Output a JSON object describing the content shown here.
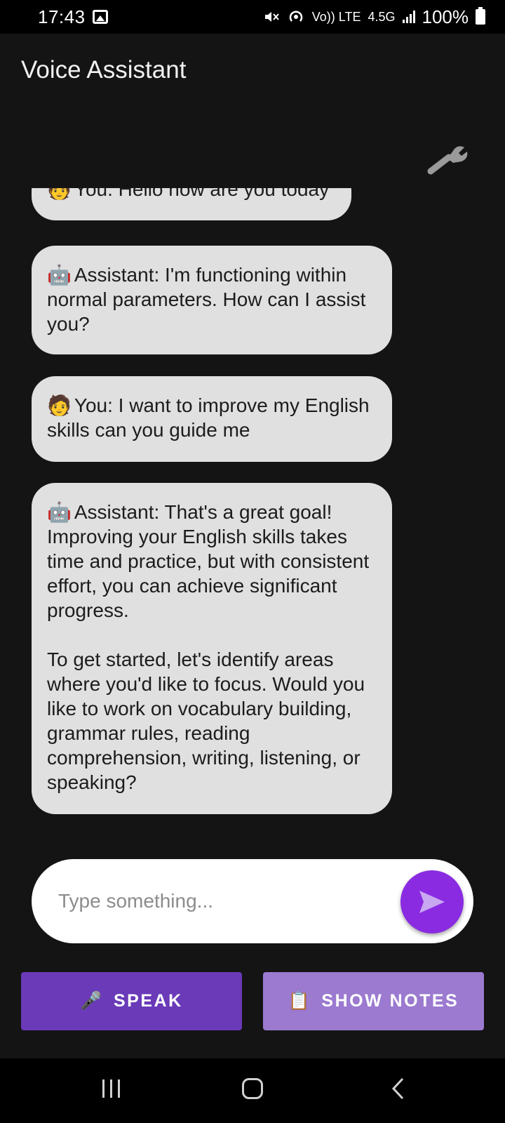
{
  "status_bar": {
    "time": "17:43",
    "volte": "Vo)) LTE",
    "network": "4.5G",
    "battery": "100%",
    "icons": [
      "gallery-icon",
      "mute-icon",
      "hotspot-icon",
      "signal-icon",
      "battery-icon"
    ]
  },
  "app": {
    "title": "Voice Assistant",
    "settings_icon": "wrench-icon"
  },
  "chat": {
    "messages": [
      {
        "emoji": "🧑",
        "text": "You: Hello how are you today"
      },
      {
        "emoji": "🤖",
        "text": "Assistant: I'm functioning within normal parameters. How can I assist you?"
      },
      {
        "emoji": "🧑",
        "text": "You: I want to improve my English skills can you guide me"
      },
      {
        "emoji": "🤖",
        "text": "Assistant: That's a great goal! Improving your English skills takes time and practice, but with consistent effort, you can achieve significant progress.\n\nTo get started, let's identify areas where you'd like to focus. Would you like to work on vocabulary building, grammar rules, reading comprehension, writing, listening, or speaking?"
      }
    ]
  },
  "input": {
    "placeholder": "Type something...",
    "value": "",
    "send_icon": "send-icon"
  },
  "buttons": {
    "speak_emoji": "🎤",
    "speak_label": "SPEAK",
    "notes_emoji": "📋",
    "notes_label": "SHOW NOTES"
  },
  "colors": {
    "background": "#141414",
    "bubble": "#e0e0e0",
    "send": "#8a2be2",
    "speak": "#6a3ab8",
    "notes": "#9b7ad0"
  }
}
